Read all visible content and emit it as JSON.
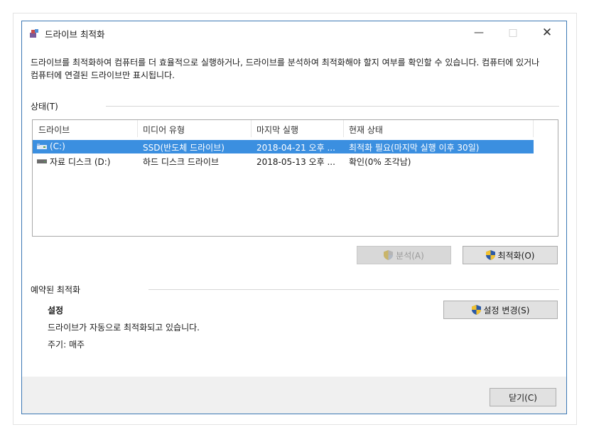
{
  "window": {
    "title": "드라이브 최적화",
    "controls": {
      "minimize": "—",
      "maximize": "□",
      "close": "✕"
    }
  },
  "description": "드라이브를 최적화하여 컴퓨터를 더 효율적으로 실행하거나, 드라이브를 분석하여 최적화해야 할지 여부를 확인할 수 있습니다. 컴퓨터에 있거나 컴퓨터에 연결된 드라이브만 표시됩니다.",
  "status_group": {
    "label": "상태(T)",
    "columns": [
      "드라이브",
      "미디어 유형",
      "마지막 실행",
      "현재 상태"
    ],
    "rows": [
      {
        "drive": "(C:)",
        "media": "SSD(반도체 드라이브)",
        "last_run": "2018-04-21 오후 ...",
        "status": "최적화 필요(마지막 실행 이후 30일)",
        "selected": true,
        "icon": "ssd-drive-icon"
      },
      {
        "drive": "자료 디스크 (D:)",
        "media": "하드 디스크 드라이브",
        "last_run": "2018-05-13 오후 ...",
        "status": "확인(0% 조각남)",
        "selected": false,
        "icon": "hdd-drive-icon"
      }
    ]
  },
  "buttons": {
    "analyze": "분석(A)",
    "optimize": "최적화(O)",
    "change_settings": "설정 변경(S)",
    "close": "닫기(C)"
  },
  "scheduled": {
    "label": "예약된 최적화",
    "heading": "설정",
    "line1": "드라이브가 자동으로 최적화되고 있습니다.",
    "line2": "주기: 매주"
  },
  "colors": {
    "selection": "#3b8fe0",
    "window_border": "#3c78b4",
    "button_face": "#e1e1e1"
  }
}
